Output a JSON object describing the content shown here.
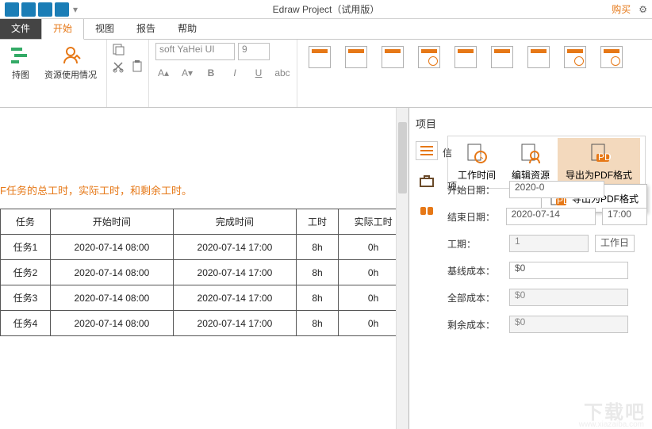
{
  "qat": {
    "title": "Edraw Project（试用版）",
    "buy": "购买"
  },
  "tabs": {
    "file": "文件",
    "home": "开始",
    "view": "视图",
    "report": "报告",
    "help": "帮助"
  },
  "ribbon": {
    "gantt": "持图",
    "resource_usage": "资源使用情况"
  },
  "font": {
    "name": "soft YaHei UI",
    "size": "9"
  },
  "caption": "F任务的总工时，实际工时，和剩余工时。",
  "table": {
    "headers": [
      "任务",
      "开始时间",
      "完成时间",
      "工时",
      "实际工时"
    ],
    "rows": [
      [
        "任务1",
        "2020-07-14 08:00",
        "2020-07-14 17:00",
        "8h",
        "0h"
      ],
      [
        "任务2",
        "2020-07-14 08:00",
        "2020-07-14 17:00",
        "8h",
        "0h"
      ],
      [
        "任务3",
        "2020-07-14 08:00",
        "2020-07-14 17:00",
        "8h",
        "0h"
      ],
      [
        "任务4",
        "2020-07-14 08:00",
        "2020-07-14 17:00",
        "8h",
        "0h"
      ]
    ]
  },
  "panel": {
    "title": "项目",
    "info_char": "信",
    "proj_char": "项",
    "toolbar": {
      "worktime": "工作时间",
      "editres": "编辑资源",
      "exportpdf": "导出为PDF格式"
    },
    "tooltip": "导出为PDF格式",
    "form": {
      "start_label": "开始日期：",
      "start_val": "2020-0",
      "end_label": "结束日期：",
      "end_val": "2020-07-14",
      "end_time": "17:00",
      "duration_label": "工期：",
      "duration_val": "1",
      "duration_unit": "工作日",
      "baseline_label": "基线成本：",
      "baseline_val": "$0",
      "total_label": "全部成本：",
      "total_val": "$0",
      "remain_label": "剩余成本：",
      "remain_val": "$0"
    }
  },
  "watermark": "下载吧",
  "wurl": "www.xiazaiba.com"
}
